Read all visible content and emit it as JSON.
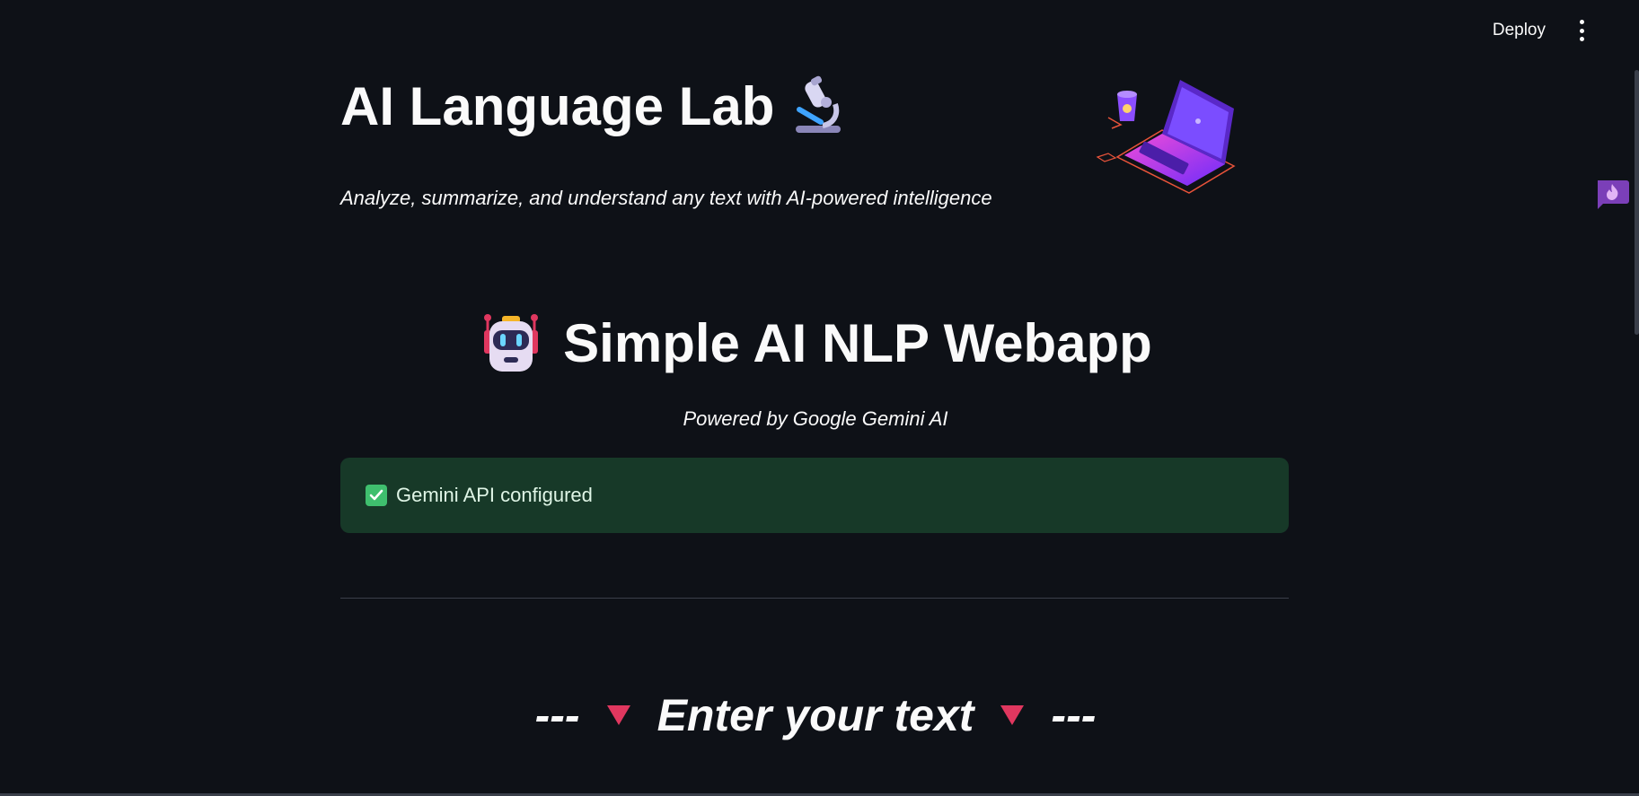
{
  "header": {
    "deploy_label": "Deploy",
    "menu_icon": "kebab-menu-icon"
  },
  "hero": {
    "title": "AI Language Lab",
    "title_emoji": "microscope-icon",
    "subtitle": "Analyze, summarize, and understand any text with AI-powered intelligence",
    "illustration": "laptop-illustration"
  },
  "app": {
    "heading": "Simple AI NLP Webapp",
    "heading_emoji": "robot-icon",
    "powered_by": "Powered by Google Gemini AI"
  },
  "status": {
    "message": "Gemini API configured",
    "icon": "check-mark-icon",
    "color": "#173928"
  },
  "section": {
    "prefix": "---",
    "label": "Enter your text",
    "suffix": "---",
    "marker_icon": "red-triangle-icon",
    "marker_color": "#e0375f"
  },
  "floating": {
    "chat_icon": "chat-fire-icon",
    "accent": "#7b3fb8"
  }
}
